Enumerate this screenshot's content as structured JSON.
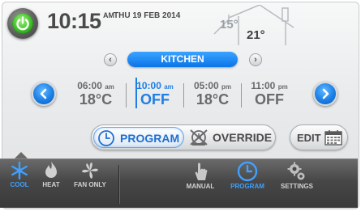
{
  "header": {
    "time": "10:15",
    "ampm": "AM",
    "date": "THU 19 FEB 2014",
    "outdoor_temp": "15°",
    "indoor_temp": "21°"
  },
  "zone": {
    "name": "KITCHEN"
  },
  "schedule": {
    "slots": [
      {
        "time": "06:00",
        "period": "am",
        "value": "18°C",
        "active": false
      },
      {
        "time": "10:00",
        "period": "am",
        "value": "OFF",
        "active": true
      },
      {
        "time": "05:00",
        "period": "pm",
        "value": "18°C",
        "active": false
      },
      {
        "time": "11:00",
        "period": "pm",
        "value": "OFF",
        "active": false
      }
    ]
  },
  "controls": {
    "program_label": "PROGRAM",
    "override_label": "OVERRIDE",
    "edit_label": "EDIT"
  },
  "bottom_tabs": {
    "cool": "COOL",
    "heat": "HEAT",
    "fan_only": "FAN ONLY",
    "manual": "MANUAL",
    "program": "PROGRAM",
    "settings": "SETTINGS"
  },
  "icons": {
    "power": "power-icon",
    "cool": "snowflake-icon",
    "heat": "flame-icon",
    "fan": "fan-icon",
    "manual": "hand-icon",
    "program": "clock-icon",
    "settings": "gear-icon",
    "edit": "calendar-icon",
    "override": "override-icon"
  },
  "colors": {
    "accent": "#1f7ee6",
    "power": "#3fbf2a",
    "bar": "#474747",
    "active_tab": "#3fa0ff"
  }
}
